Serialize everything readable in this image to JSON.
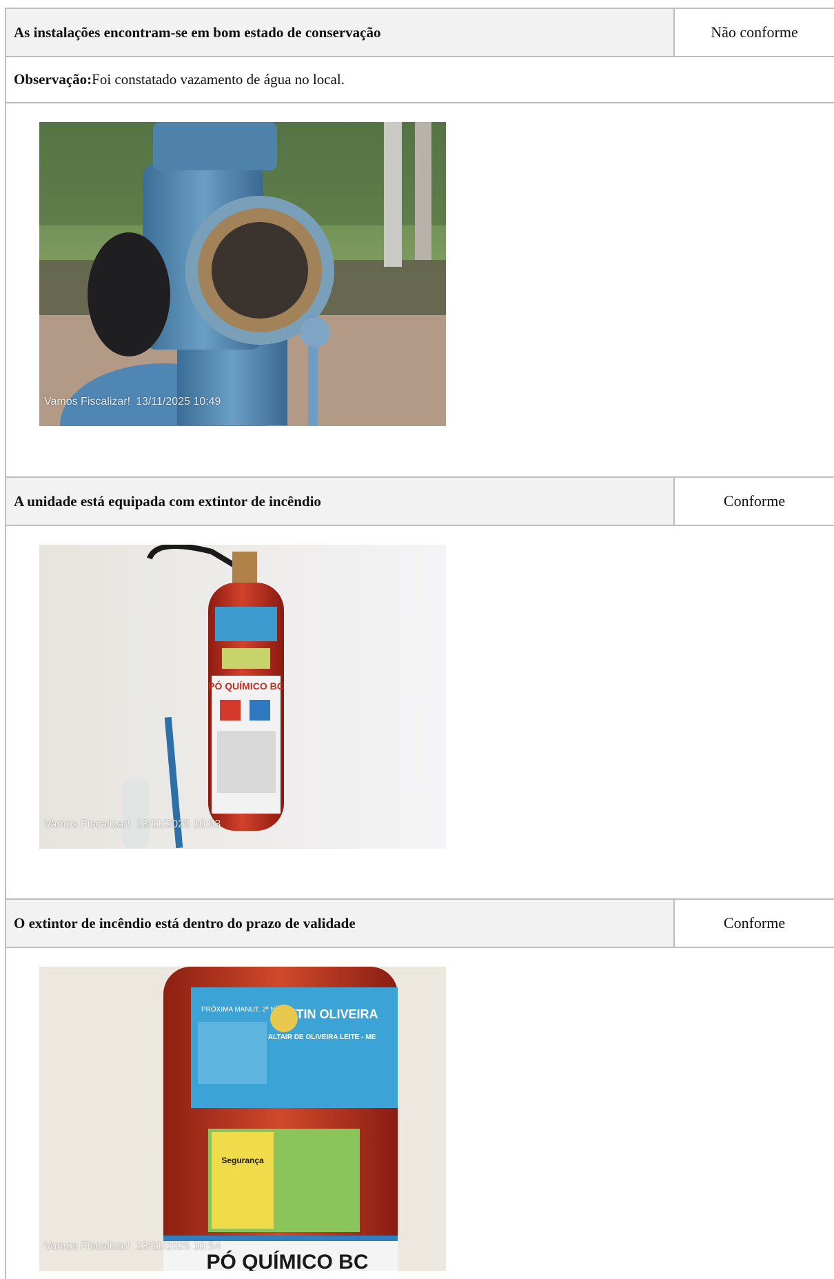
{
  "items": [
    {
      "question": "As instalações encontram-se em bom estado de conservação",
      "status": "Não conforme",
      "observation_label": "Observação:",
      "observation_text": " Foi constatado vazamento de água no local.",
      "photo_stamp_app": "Vamos Fiscalizar!",
      "photo_stamp_datetime": "13/11/2025 10:49"
    },
    {
      "question": "A unidade está equipada com extintor de incêndio",
      "status": "Conforme",
      "photo_stamp_app": "Vamos Fiscalizar!",
      "photo_stamp_datetime": "13/11/2025 10:53",
      "photo_label_text": "PÓ QUÍMICO BC"
    },
    {
      "question": "O extintor de incêndio está dentro do prazo de validade",
      "status": "Conforme",
      "photo_stamp_app": "Vamos Fiscalizar!",
      "photo_stamp_datetime": "13/11/2025 10:54",
      "photo_label_brand": "EXTIN OLIVEIRA",
      "photo_label_owner": "ALTAIR DE OLIVEIRA LEITE - ME",
      "photo_label_next": "PRÓXIMA MANUT. 2º NÍVEL",
      "photo_label_seal": "Segurança",
      "photo_label_bottom": "PÓ QUÍMICO BC"
    }
  ]
}
